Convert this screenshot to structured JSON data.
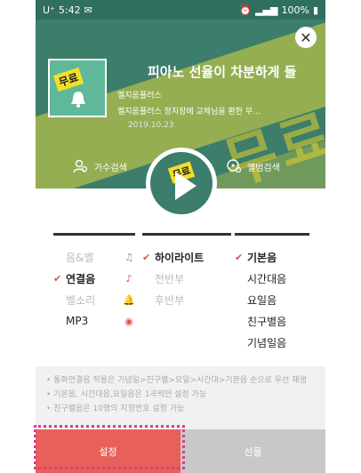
{
  "status_bar": {
    "carrier": "U⁺",
    "time": "5:42",
    "battery": "100%"
  },
  "header": {
    "song_title": "피아노 선율이 차분하게 들",
    "artist": "멜지음플러스",
    "description": "멜지음플러스 정지장에 교체님을 환한 무…",
    "date": "2019.10.23",
    "free_badge": "무료",
    "watermark": "무료",
    "actions": [
      {
        "label": "가수검색",
        "icon": "person-search-icon"
      },
      {
        "label": "앨범검색",
        "icon": "disc-search-icon"
      }
    ],
    "disc_badge": "무료"
  },
  "options": {
    "col1": [
      {
        "label": "음&벨",
        "selected": false,
        "icon": "note-bell-icon",
        "icon_red": false
      },
      {
        "label": "연결음",
        "selected": true,
        "icon": "note-icon",
        "icon_red": true
      },
      {
        "label": "벨소리",
        "selected": false,
        "icon": "bell-icon",
        "icon_red": false
      },
      {
        "label": "MP3",
        "selected": false,
        "dark": true,
        "icon": "mp3-icon",
        "icon_red": true
      }
    ],
    "col2": [
      {
        "label": "하이라이트",
        "selected": true
      },
      {
        "label": "전반부",
        "selected": false
      },
      {
        "label": "후반부",
        "selected": false
      }
    ],
    "col3": [
      {
        "label": "기본음",
        "selected": true
      },
      {
        "label": "시간대음",
        "selected": false,
        "dark": true
      },
      {
        "label": "요일음",
        "selected": false,
        "dark": true
      },
      {
        "label": "친구별음",
        "selected": false,
        "dark": true
      },
      {
        "label": "기념일음",
        "selected": false,
        "dark": true
      }
    ]
  },
  "notes": [
    "• 통화연결음 적용은 기념일>친구별>요일>시간대>기본음 순으로 우선 재생",
    "• 기본음, 시간대음,요일음은 1곡씩만 설정 가능",
    "• 친구별음은 10명의 지정번호 설정 가능"
  ],
  "buttons": {
    "set": "설정",
    "gift": "선물"
  }
}
